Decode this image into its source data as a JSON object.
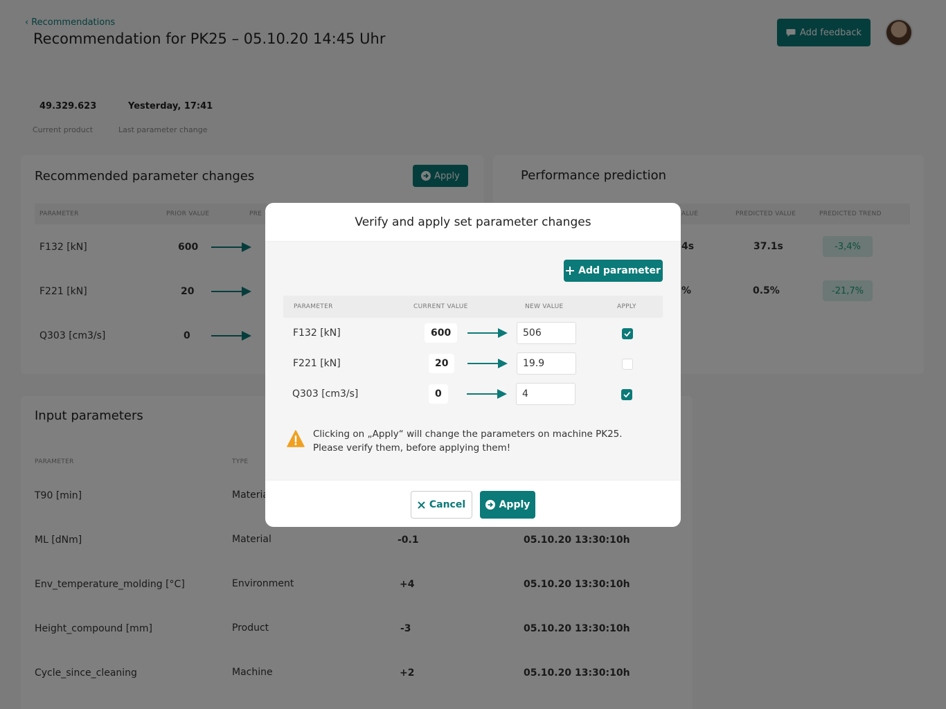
{
  "header": {
    "back_label": "Recommendations",
    "title": "Recommendation for PK25 – 05.10.20 14:45 Uhr",
    "feedback_label": "Add feedback"
  },
  "stats": [
    {
      "value": "49.329.623",
      "label": "Current product"
    },
    {
      "value": "Yesterday, 17:41",
      "label": "Last parameter change"
    }
  ],
  "recommended": {
    "title": "Recommended parameter changes",
    "apply_label": "Apply",
    "columns": [
      "Parameter",
      "Prior value",
      "Pre"
    ],
    "rows": [
      {
        "name": "F132 [kN]",
        "prior": "600"
      },
      {
        "name": "F221 [kN]",
        "prior": "20"
      },
      {
        "name": "Q303 [cm3/s]",
        "prior": "0"
      }
    ]
  },
  "performance": {
    "title": "Performance prediction",
    "columns": [
      "alue",
      "Predicted value",
      "Predicted trend"
    ],
    "rows": [
      {
        "partial": "4s",
        "predicted": "37.1s",
        "trend": "-3,4%"
      },
      {
        "partial": "%",
        "predicted": "0.5%",
        "trend": "-21,7%"
      }
    ]
  },
  "inputs": {
    "title": "Input parameters",
    "columns": [
      "Parameter",
      "Type"
    ],
    "rows": [
      {
        "name": "T90 [min]",
        "type": "Materia",
        "delta": "",
        "time": ""
      },
      {
        "name": "ML [dNm]",
        "type": "Material",
        "delta": "-0.1",
        "time": "05.10.20 13:30:10h"
      },
      {
        "name": "Env_temperature_molding [°C]",
        "type": "Environment",
        "delta": "+4",
        "time": "05.10.20 13:30:10h"
      },
      {
        "name": "Height_compound [mm]",
        "type": "Product",
        "delta": "-3",
        "time": "05.10.20 13:30:10h"
      },
      {
        "name": "Cycle_since_cleaning",
        "type": "Machine",
        "delta": "+2",
        "time": "05.10.20 13:30:10h"
      }
    ]
  },
  "modal": {
    "title": "Verify and apply set parameter changes",
    "add_param_label": "Add parameter",
    "columns": [
      "Parameter",
      "Current value",
      "New value",
      "Apply"
    ],
    "rows": [
      {
        "name": "F132 [kN]",
        "current": "600",
        "new": "506",
        "apply": true
      },
      {
        "name": "F221 [kN]",
        "current": "20",
        "new": "19.9",
        "apply": false
      },
      {
        "name": "Q303 [cm3/s]",
        "current": "0",
        "new": "4",
        "apply": true
      }
    ],
    "warning_line1": "Clicking on „Apply“ will change the parameters on machine PK25.",
    "warning_line2": "Please verify them, before applying them!",
    "cancel_label": "Cancel",
    "apply_label": "Apply"
  },
  "colors": {
    "accent": "#0b7a78",
    "warning": "#f0a020",
    "trend_bg": "#d7f0ea",
    "trend_text": "#1a9e78"
  }
}
